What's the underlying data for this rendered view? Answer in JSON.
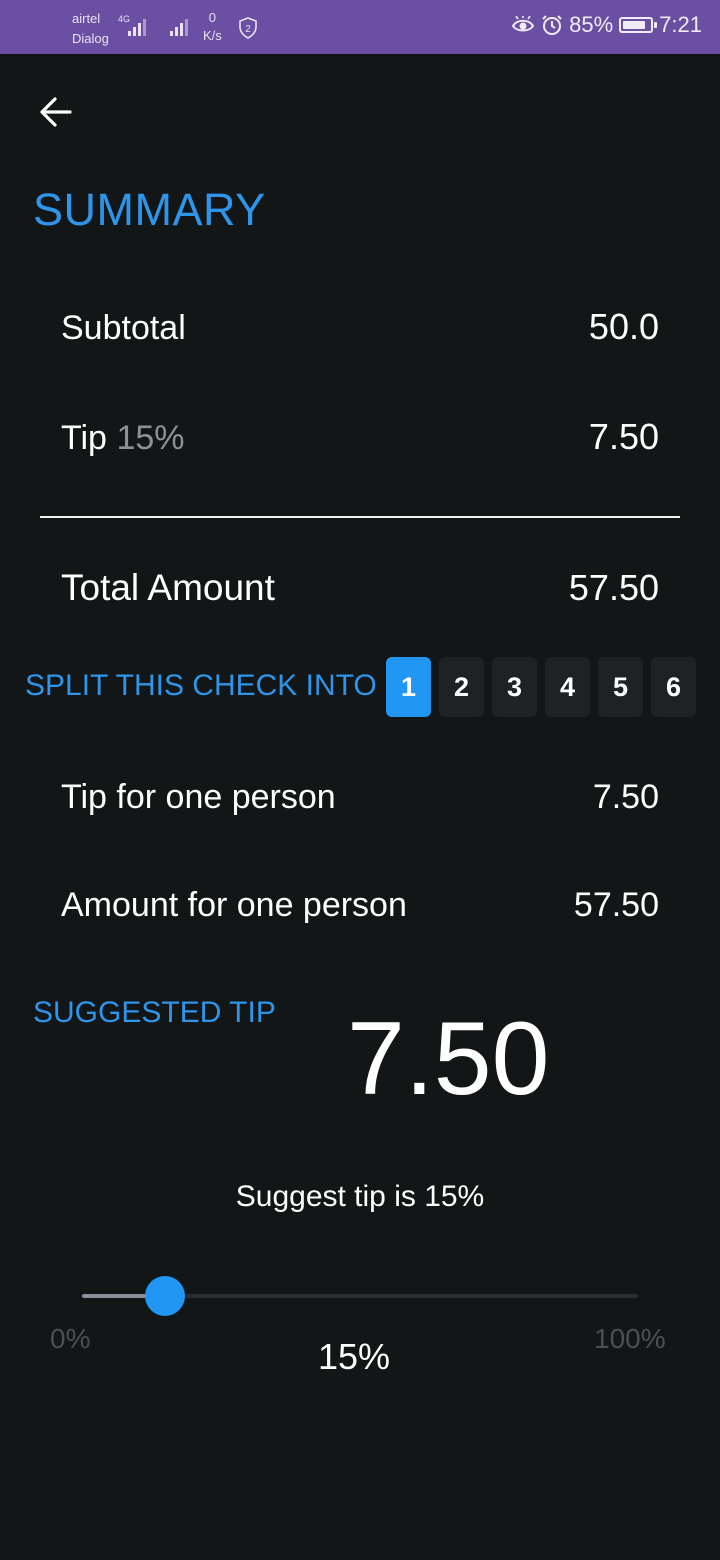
{
  "status_bar": {
    "carrier_1": "airtel",
    "carrier_2": "Dialog",
    "network": "4G",
    "speed_value": "0",
    "speed_unit": "K/s",
    "shield_badge": "2",
    "battery": "85%",
    "battery_level": 0.85,
    "time": "7:21",
    "icons": [
      "eye-icon",
      "alarm-icon",
      "battery-icon"
    ]
  },
  "header": {
    "back_icon": "arrow-left-icon",
    "title": "SUMMARY"
  },
  "summary": {
    "subtotal_label": "Subtotal",
    "subtotal_value": "50.0",
    "tip_label": "Tip",
    "tip_percent": "15%",
    "tip_value": "7.50",
    "total_label": "Total Amount",
    "total_value": "57.50"
  },
  "split": {
    "label": "SPLIT THIS CHECK INTO",
    "options": [
      "1",
      "2",
      "3",
      "4",
      "5",
      "6"
    ],
    "selected": "1"
  },
  "per_person": {
    "tip_label": "Tip for one person",
    "tip_value": "7.50",
    "amount_label": "Amount for one person",
    "amount_value": "57.50"
  },
  "suggested": {
    "label": "SUGGESTED TIP",
    "value": "7.50",
    "text": "Suggest tip is 15%"
  },
  "slider": {
    "min_label": "0%",
    "max_label": "100%",
    "current_label": "15%",
    "value": 0.15
  },
  "colors": {
    "accent": "#2196f3",
    "background": "#121617",
    "status_bar": "#6a4fa3"
  }
}
